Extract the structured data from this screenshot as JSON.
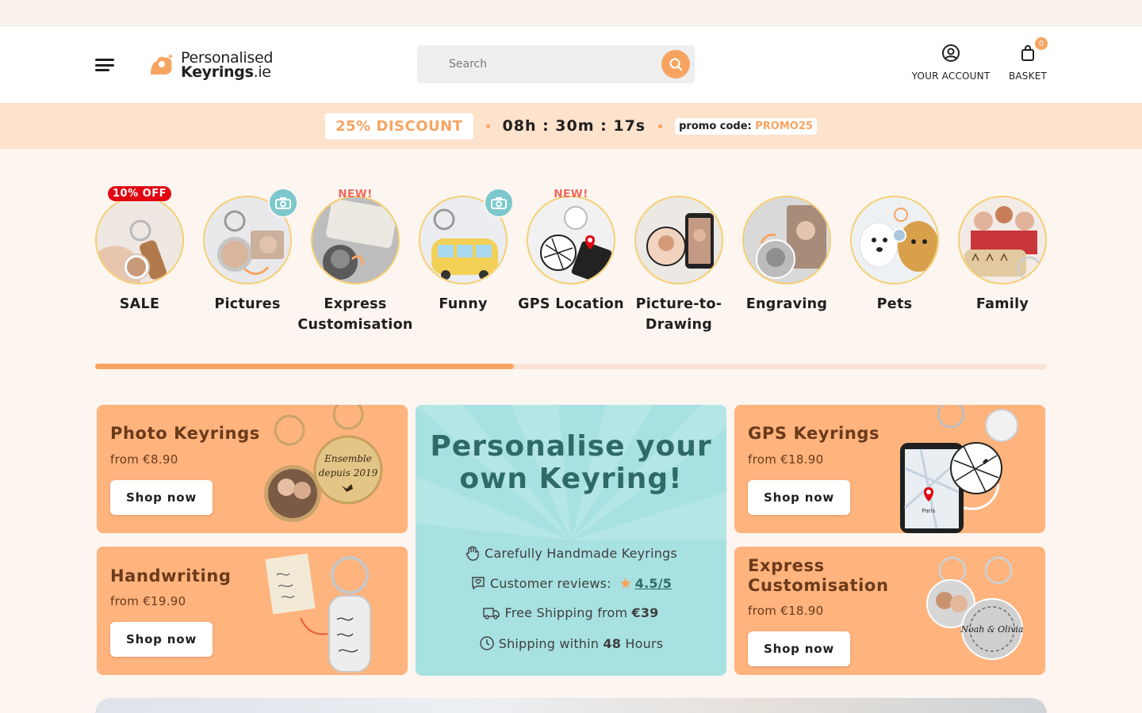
{
  "header": {
    "logo_line1": "Personalised",
    "logo_line2": "Keyrings",
    "logo_tld": ".ie",
    "search_placeholder": "Search",
    "account_label": "YOUR ACCOUNT",
    "basket_label": "BASKET",
    "basket_count": "0"
  },
  "promo": {
    "discount": "25% DISCOUNT",
    "timer": "08h : 30m : 17s",
    "code_label": "promo code:",
    "code_value": "PROMO25"
  },
  "categories": [
    {
      "name": "SALE",
      "badge": "10% OFF"
    },
    {
      "name": "Pictures",
      "badge": ""
    },
    {
      "name": "Express Customisation",
      "badge": "NEW!"
    },
    {
      "name": "Funny",
      "badge": ""
    },
    {
      "name": "GPS Location",
      "badge": "NEW!"
    },
    {
      "name": "Picture-to-Drawing",
      "badge": ""
    },
    {
      "name": "Engraving",
      "badge": ""
    },
    {
      "name": "Pets",
      "badge": ""
    },
    {
      "name": "Family",
      "badge": ""
    }
  ],
  "category_scroll_progress": 0.44,
  "cards": {
    "photo": {
      "title": "Photo Keyrings",
      "price": "from €8.90",
      "button": "Shop now",
      "art_text1": "Ensemble",
      "art_text2": "depuis 2019"
    },
    "handwriting": {
      "title": "Handwriting",
      "price": "from €19.90",
      "button": "Shop now"
    },
    "gps": {
      "title": "GPS Keyrings",
      "price": "from €18.90",
      "button": "Shop now",
      "map_label": "Paris"
    },
    "express": {
      "title": "Express Customisation",
      "price": "from €18.90",
      "button": "Shop now",
      "art_text": "Noah & Olivia"
    }
  },
  "center": {
    "title": "Personalise your own Keyring!",
    "line1": "Carefully Handmade Keyrings",
    "line2_label": "Customer reviews:",
    "rating": "4.5/5",
    "line3_prefix": "Free Shipping from ",
    "line3_value": "€39",
    "line4_prefix": "Shipping within ",
    "line4_value": "48",
    "line4_suffix": " Hours"
  },
  "colors": {
    "accent": "#f7a462",
    "card_bg": "#ffb37d",
    "card_text": "#6a3a1b",
    "teal_card": "#a8e1e1",
    "teal_text": "#2e6b66",
    "promo_bg": "#fde2cc",
    "sale_red": "#e30613",
    "new_red": "#f06a5e"
  },
  "icons": [
    "menu-icon",
    "logo-icon",
    "search-icon",
    "user-icon",
    "bag-icon",
    "camera-icon",
    "hand-icon",
    "review-icon",
    "truck-icon",
    "clock-icon",
    "star-icon"
  ]
}
